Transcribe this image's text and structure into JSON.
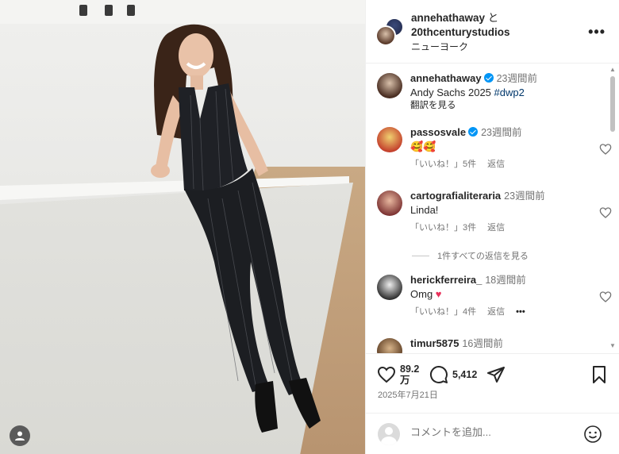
{
  "header": {
    "owner": "annehathaway",
    "and": "と",
    "collaborator": "20thcenturystudios",
    "location": "ニューヨーク",
    "more_icon": "more-horizontal-icon"
  },
  "caption": {
    "username": "annehathaway",
    "time": "23週間前",
    "text": "Andy Sachs 2025",
    "hashtag": "#dwp2",
    "translate": "翻訳を見る"
  },
  "comments": [
    {
      "username": "passosvale",
      "verified": true,
      "time": "23週間前",
      "text": "🥰🥰",
      "likes": "「いいね！」5件",
      "reply": "返信"
    },
    {
      "username": "cartografialiteraria",
      "verified": false,
      "time": "23週間前",
      "text": "Linda!",
      "likes": "「いいね！」3件",
      "reply": "返信"
    },
    {
      "username": "herickferreira_",
      "verified": false,
      "time": "18週間前",
      "text": "Omg",
      "likes": "「いいね！」4件",
      "reply": "返信",
      "more": "•••"
    },
    {
      "username": "timur5875",
      "verified": false,
      "time": "16週間前",
      "text": "",
      "likes": "",
      "reply": ""
    }
  ],
  "view_replies": "1件すべての返信を見る",
  "actions": {
    "likes": "89.2万",
    "likes_line1": "89.2",
    "likes_line2": "万",
    "comments": "5,412",
    "date": "2025年7月21日"
  },
  "add_comment": {
    "placeholder": "コメントを追加..."
  },
  "colors": {
    "verified": "#0095f6",
    "hashtag": "#00376b",
    "secondary_text": "#737373"
  }
}
